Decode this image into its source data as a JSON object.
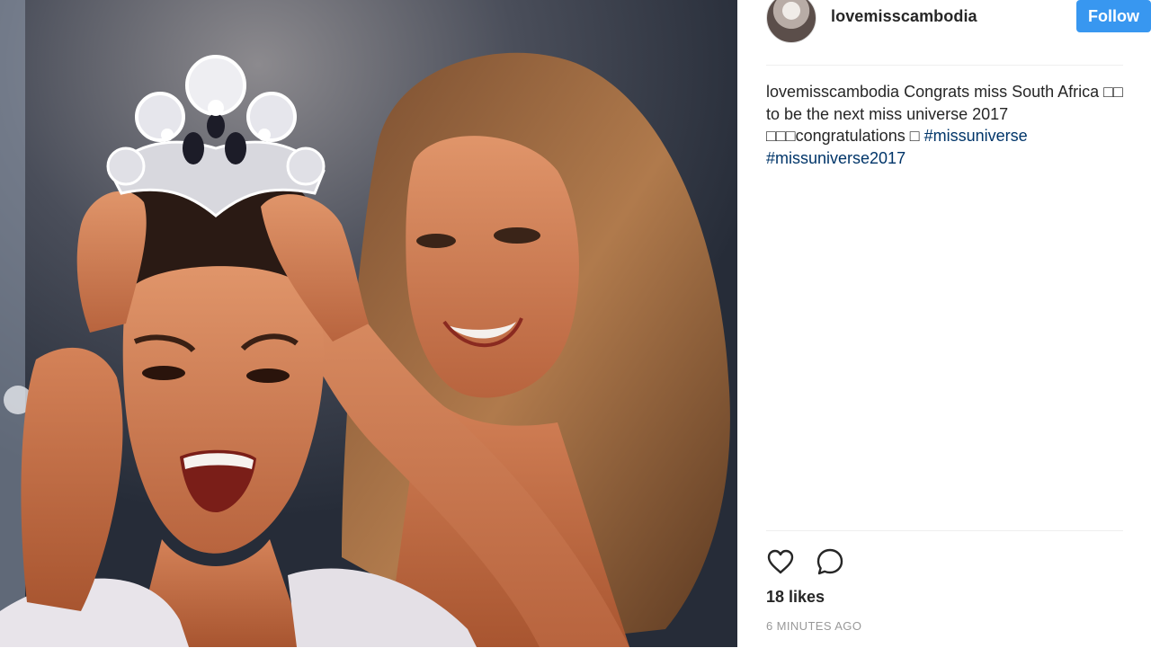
{
  "post": {
    "photo_name": "photo",
    "username": "lovemisscambodia",
    "follow_label": "Follow",
    "caption": {
      "user": "lovemisscambodia",
      "text_1": " Congrats miss South Africa ",
      "emoji_1": "□□",
      "text_2": " to be the next miss universe 2017 ",
      "emoji_2": "□□□",
      "text_3": "congratulations ",
      "emoji_3": "□",
      "text_4": " ",
      "hashtag_1": "#missuniverse",
      "hashtag_2": "#missuniverse2017"
    },
    "likes": "18 likes",
    "time": "6 MINUTES AGO"
  },
  "icons": {
    "like": "heart-icon",
    "comment": "speech-bubble-icon"
  },
  "colors": {
    "follow_button": "#3897f0",
    "hashtag": "#003569",
    "time": "#999999"
  }
}
